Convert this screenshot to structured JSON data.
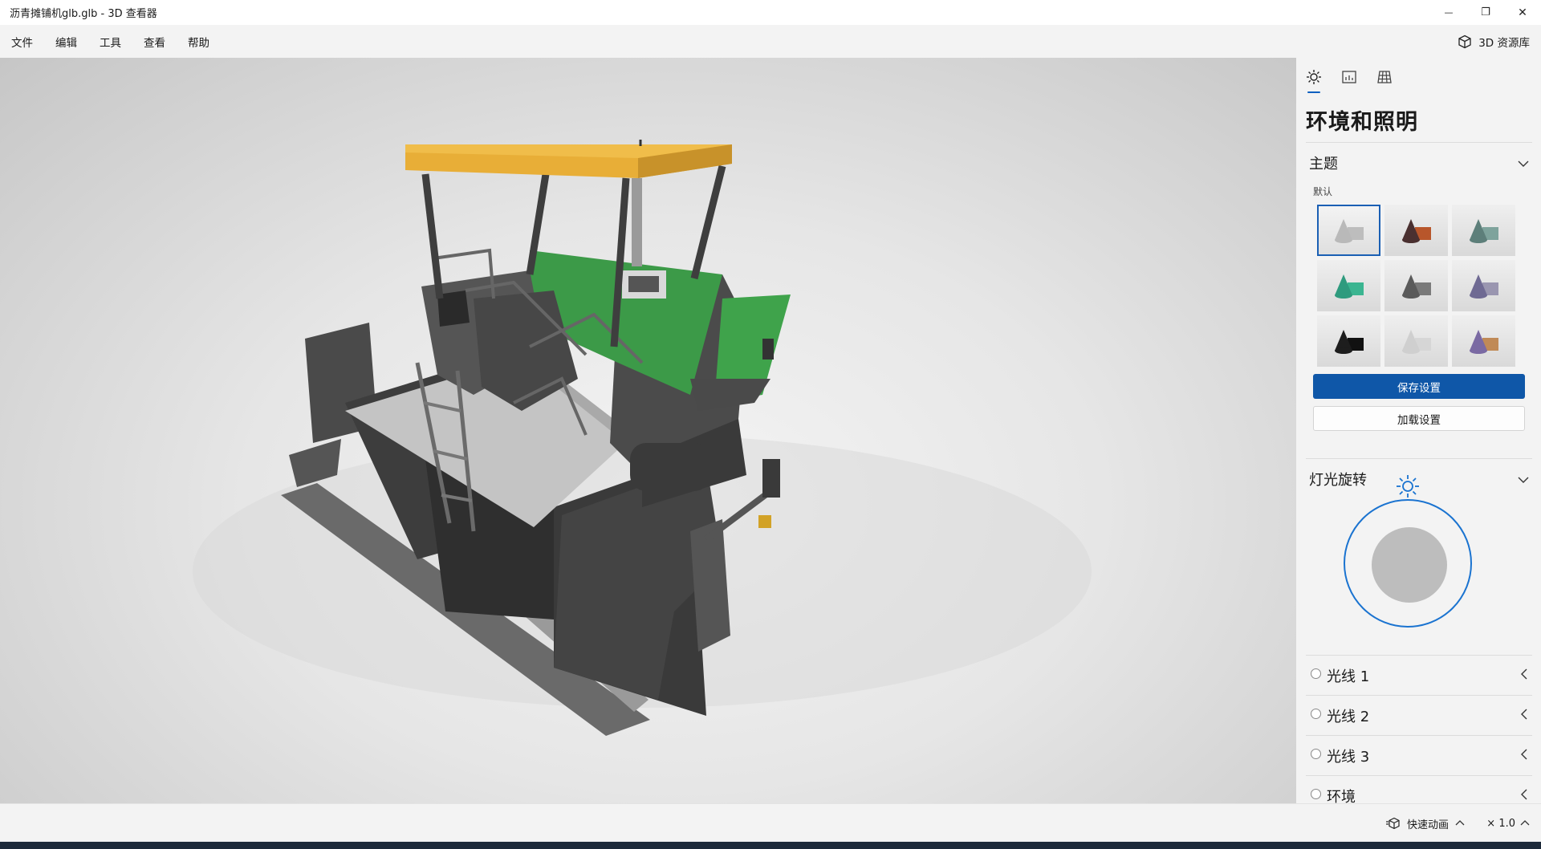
{
  "window": {
    "title": "沥青摊铺机glb.glb - 3D 查看器",
    "minimize_glyph": "—",
    "restore_glyph": "❐",
    "close_glyph": "✕"
  },
  "menu": {
    "items": [
      "文件",
      "编辑",
      "工具",
      "查看",
      "帮助"
    ],
    "library_label": "3D 资源库"
  },
  "panel": {
    "tabs": [
      "sun-icon",
      "stats-icon",
      "grid-icon"
    ],
    "title": "环境和照明",
    "theme_section": {
      "title": "主题",
      "default_label": "默认",
      "themes": [
        {
          "id": "default",
          "selected": true,
          "cone": "#b9b9b9",
          "box": "#bdbdbd"
        },
        {
          "id": "warm",
          "cone": "#4a3030",
          "box": "#b8562b"
        },
        {
          "id": "teal-grey",
          "cone": "#5d7f7a",
          "box": "#7ea39c"
        },
        {
          "id": "teal",
          "cone": "#2f9b7e",
          "box": "#3bb591"
        },
        {
          "id": "grey",
          "cone": "#5a5a5a",
          "box": "#7a7a7a"
        },
        {
          "id": "violet",
          "cone": "#6f6a93",
          "box": "#9a96b0"
        },
        {
          "id": "black",
          "cone": "#1d1d1d",
          "box": "#111111"
        },
        {
          "id": "light",
          "cone": "#cfcfcf",
          "box": "#d6d6d6"
        },
        {
          "id": "sunset",
          "cone": "#7a6aa3",
          "box": "#c08a57"
        }
      ],
      "save_label": "保存设置",
      "load_label": "加载设置"
    },
    "light_section": {
      "title": "灯光旋转",
      "lights": [
        "光线 1",
        "光线 2",
        "光线 3",
        "环境"
      ]
    }
  },
  "status": {
    "animation_label": "快速动画",
    "zoom_label": "× 1.0"
  },
  "colors": {
    "accent": "#0f57a8",
    "dial": "#1a73d0",
    "canopy": "#e8ae37",
    "machine_green": "#3c9a48",
    "machine_grey": "#4f4f4f"
  }
}
